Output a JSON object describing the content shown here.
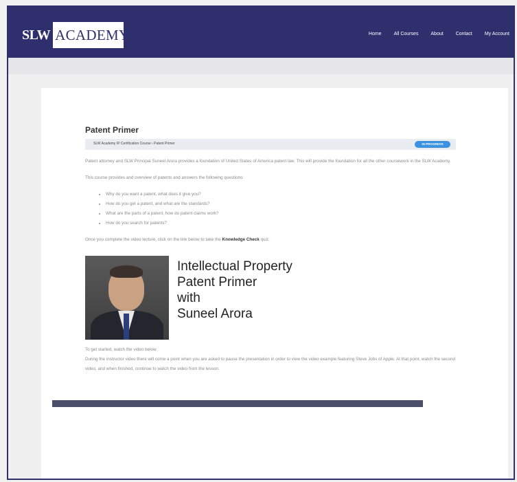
{
  "header": {
    "logo_slw": "SLW",
    "logo_academy": "ACADEMY",
    "nav": [
      "Home",
      "All Courses",
      "About",
      "Contact",
      "My Account"
    ]
  },
  "course": {
    "title": "Patent Primer",
    "breadcrumb": "SLW Academy IP Certification Course › Patent Primer",
    "status_badge": "IN PROGRESS",
    "intro": "Patent attorney and SLW Principal Suneel Arora provides a foundation of United States of America patent law. This will provide the foundation for all the other coursework in the SLW Academy.",
    "overview": "This course provides and overview of patents and answers the following questions:",
    "questions": [
      "Why do you want a patent, what does it give you?",
      "How do you get a patent, and what are the standards?",
      "What are the parts of a patent, how do patent claims work?",
      "How do you search for patents?"
    ],
    "cta_before": "Once you complete the video lecture, click on the link below to take the ",
    "cta_link": "Knowledge Check",
    "cta_after": " quiz.",
    "banner_lines": [
      "Intellectual Property",
      "Patent Primer",
      "with",
      "Suneel Arora"
    ],
    "get_started": "To get started, watch the video below.",
    "instructions": "During the instructor video there will come a point when you are asked to pause the presentation in order to view the video example featuring Steve Jobs of Apple. At that point, watch the second video, and when finished, continue to watch the video from the lesson."
  },
  "colors": {
    "navbar": "#2f2f6e",
    "badge": "#3a92e0"
  }
}
